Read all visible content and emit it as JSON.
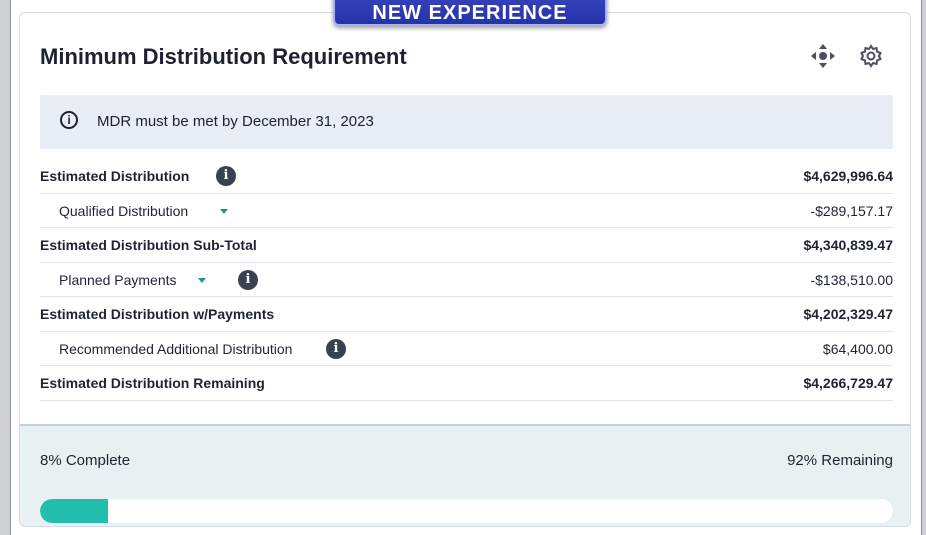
{
  "banner": "NEW EXPERIENCE",
  "card": {
    "title": "Minimum Distribution Requirement",
    "header_icons": [
      "move-icon",
      "gear-icon"
    ]
  },
  "info": {
    "icon": "info-circle-icon",
    "text": "MDR must be met by December 31, 2023"
  },
  "rows": [
    {
      "label": "Estimated Distribution",
      "amount": "$4,629,996.64",
      "bold": true,
      "info": true,
      "dropdown": false
    },
    {
      "label": "Qualified Distribution",
      "amount": "-$289,157.17",
      "bold": false,
      "info": false,
      "dropdown": true
    },
    {
      "label": "Estimated Distribution Sub-Total",
      "amount": "$4,340,839.47",
      "bold": true,
      "info": false,
      "dropdown": false
    },
    {
      "label": "Planned Payments",
      "amount": "-$138,510.00",
      "bold": false,
      "info": true,
      "dropdown": true
    },
    {
      "label": "Estimated Distribution w/Payments",
      "amount": "$4,202,329.47",
      "bold": true,
      "info": false,
      "dropdown": false
    },
    {
      "label": "Recommended Additional Distribution",
      "amount": "$64,400.00",
      "bold": false,
      "info": true,
      "dropdown": false
    },
    {
      "label": "Estimated Distribution Remaining",
      "amount": "$4,266,729.47",
      "bold": true,
      "info": false,
      "dropdown": false
    }
  ],
  "progress": {
    "complete_label": "8% Complete",
    "remaining_label": "92% Remaining",
    "percent": 8,
    "color": "#22bfae"
  }
}
